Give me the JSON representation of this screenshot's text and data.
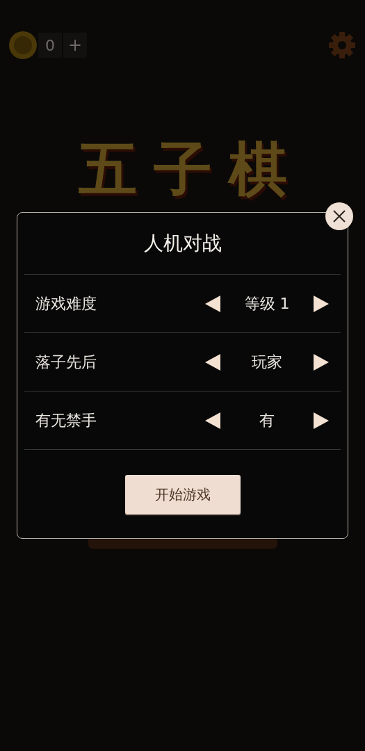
{
  "top_bar": {
    "coins": "0",
    "add": "+"
  },
  "logo": "五子棋",
  "dialog": {
    "title": "人机对战",
    "settings": [
      {
        "label": "游戏难度",
        "value": "等级 1"
      },
      {
        "label": "落子先后",
        "value": "玩家"
      },
      {
        "label": "有无禁手",
        "value": "有"
      }
    ],
    "start_button": "开始游戏"
  }
}
